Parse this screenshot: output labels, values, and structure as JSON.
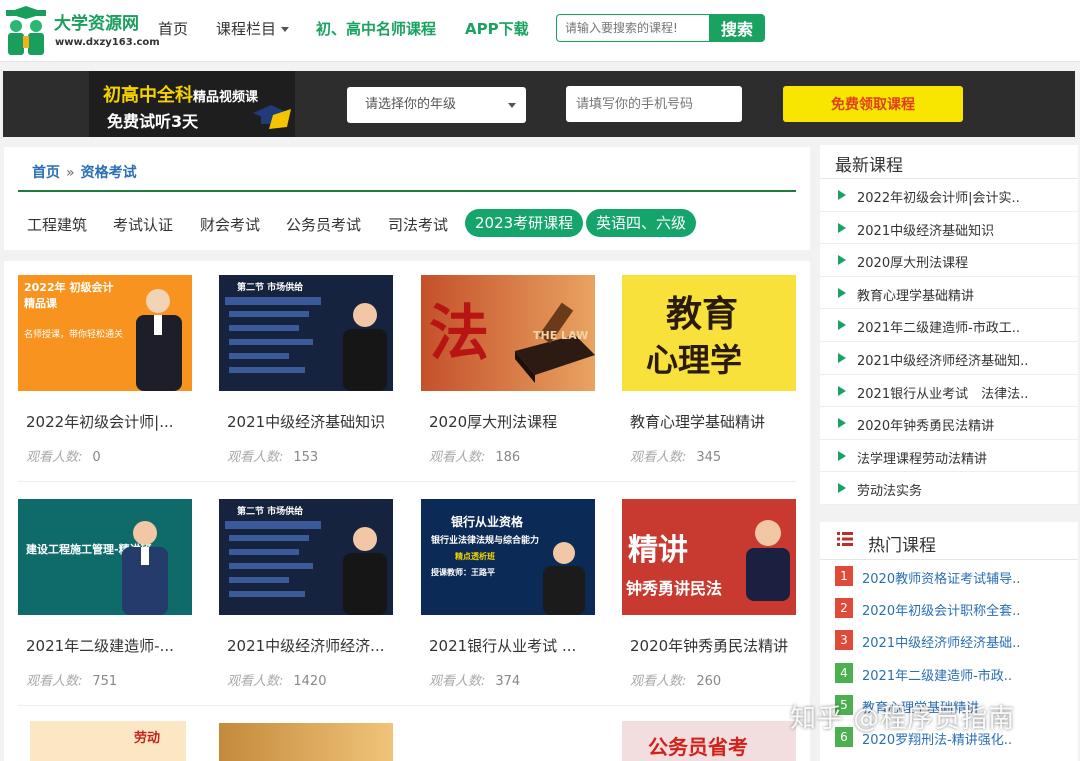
{
  "header": {
    "logo_title": "大学资源网",
    "logo_url": "www.dxzy163.com",
    "nav": [
      {
        "label": "首页"
      },
      {
        "label": "课程栏目"
      },
      {
        "label": "初、高中名师课程"
      },
      {
        "label": "APP下载"
      }
    ],
    "search_placeholder": "请输入要搜索的课程!",
    "search_button": "搜索",
    "accent_color": "#1aa260"
  },
  "promo": {
    "line1_main": "初高中全科",
    "line1_small": "精品视频课",
    "line2": "免费试听3天",
    "grade_select": "请选择你的年级",
    "phone_placeholder": "请填写你的手机号码",
    "submit_button": "免费领取课程"
  },
  "breadcrumb": {
    "home": "首页",
    "separator": "»",
    "current": "资格考试"
  },
  "tabs": [
    {
      "label": "工程建筑"
    },
    {
      "label": "考试认证"
    },
    {
      "label": "财会考试"
    },
    {
      "label": "公务员考试"
    },
    {
      "label": "司法考试"
    },
    {
      "label": "2023考研课程"
    },
    {
      "label": "英语四、六级"
    }
  ],
  "views_label": "观看人数:",
  "courses": [
    {
      "title": "2022年初级会计师|...",
      "views": "0",
      "thumb_text": "2022年 初级会计精品课",
      "thumb_sub": "名师授课，带你轻松通关"
    },
    {
      "title": "2021中级经济基础知识",
      "views": "153",
      "thumb_text": "第二节 市场供给"
    },
    {
      "title": "2020厚大刑法课程",
      "views": "186",
      "thumb_text": "法",
      "thumb_sub": "THE LAW"
    },
    {
      "title": "教育心理学基础精讲",
      "views": "345",
      "thumb_text": "教育",
      "thumb_sub": "心理学"
    },
    {
      "title": "2021年二级建造师-...",
      "views": "751",
      "thumb_text": "建设工程施工管理-精讲班"
    },
    {
      "title": "2021中级经济师经济...",
      "views": "1420",
      "thumb_text": "第二节 市场供给"
    },
    {
      "title": "2021银行从业考试 ...",
      "views": "374",
      "thumb_text": "银行从业资格",
      "thumb_sub": "银行业法律法规与综合能力",
      "thumb_note": "精点透析班",
      "thumb_teacher": "授课教师：王路平"
    },
    {
      "title": "2020年钟秀勇民法精讲",
      "views": "260",
      "thumb_text": "精讲",
      "thumb_sub": "钟秀勇讲民法"
    }
  ],
  "partial_thumbs": [
    {
      "thumb_text": "劳动"
    },
    {
      "thumb_text": ""
    },
    {
      "thumb_text": ""
    },
    {
      "thumb_text": "公务员省考"
    }
  ],
  "latest": {
    "title": "最新课程",
    "items": [
      {
        "label": "2022年初级会计师|会计实.."
      },
      {
        "label": "2021中级经济基础知识"
      },
      {
        "label": "2020厚大刑法课程"
      },
      {
        "label": "教育心理学基础精讲"
      },
      {
        "label": "2021年二级建造师-市政工.."
      },
      {
        "label": "2021中级经济师经济基础知.."
      },
      {
        "label": "2021银行从业考试　法律法.."
      },
      {
        "label": "2020年钟秀勇民法精讲"
      },
      {
        "label": "法学理课程劳动法精讲"
      },
      {
        "label": "劳动法实务"
      }
    ]
  },
  "hot": {
    "title": "热门课程",
    "items": [
      {
        "rank": "1",
        "label": "2020教师资格证考试辅导..",
        "color": "#e04a3a"
      },
      {
        "rank": "2",
        "label": "2020年初级会计职称全套..",
        "color": "#e04a3a"
      },
      {
        "rank": "3",
        "label": "2021中级经济师经济基础..",
        "color": "#e04a3a"
      },
      {
        "rank": "4",
        "label": "2021年二级建造师-市政..",
        "color": "#4caf50"
      },
      {
        "rank": "5",
        "label": "教育心理学基础精讲",
        "color": "#4caf50"
      },
      {
        "rank": "6",
        "label": "2020罗翔刑法-精讲强化..",
        "color": "#4caf50"
      }
    ]
  },
  "watermark": "知乎 @程序员指南"
}
